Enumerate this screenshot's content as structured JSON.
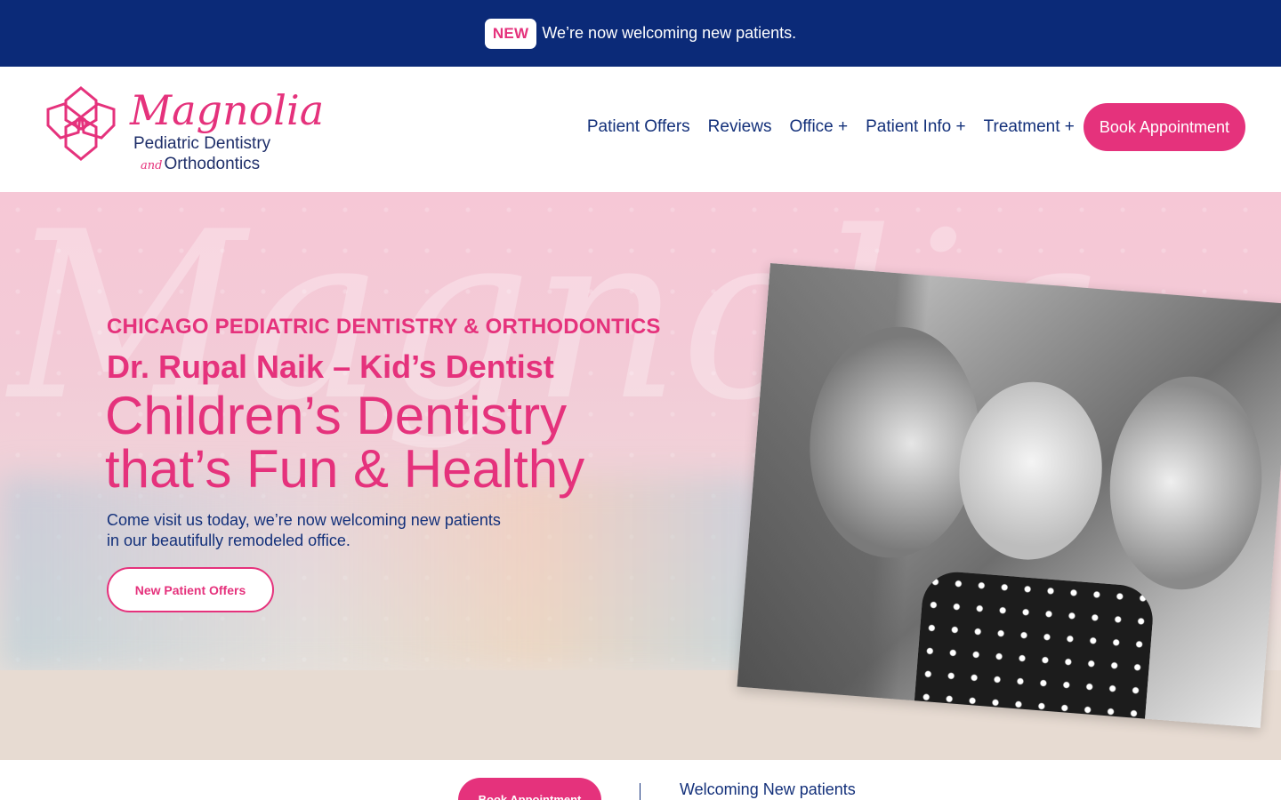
{
  "announcement": {
    "badge": "NEW",
    "message": "We’re now welcoming new patients."
  },
  "logo": {
    "script_name": "Magnolia",
    "line1": "Pediatric Dentistry",
    "line2_and": "and",
    "line2": "Orthodontics",
    "icon": "magnolia-flower-icon"
  },
  "nav": {
    "items": [
      {
        "label": "Patient Offers"
      },
      {
        "label": "Reviews"
      },
      {
        "label": "Office +"
      },
      {
        "label": "Patient Info +"
      },
      {
        "label": "Treatment +"
      }
    ],
    "cta": "Book Appointment"
  },
  "hero": {
    "eyebrow": "CHICAGO PEDIATRIC DENTISTRY & ORTHODONTICS",
    "doctor": "Dr. Rupal Naik – Kid’s Dentist",
    "headline_line1": "Children’s Dentistry",
    "headline_line2": "that’s Fun & Healthy",
    "sub_line1": "Come visit us today, we’re now welcoming new patients",
    "sub_line2": "in our beautifully remodeled office.",
    "button": "New Patient Offers"
  },
  "bottom": {
    "button": "Book Appointment",
    "welcome": "Welcoming New patients"
  },
  "colors": {
    "primary_pink": "#e5327c",
    "navy": "#0b2a78",
    "text_navy": "#13307a"
  }
}
